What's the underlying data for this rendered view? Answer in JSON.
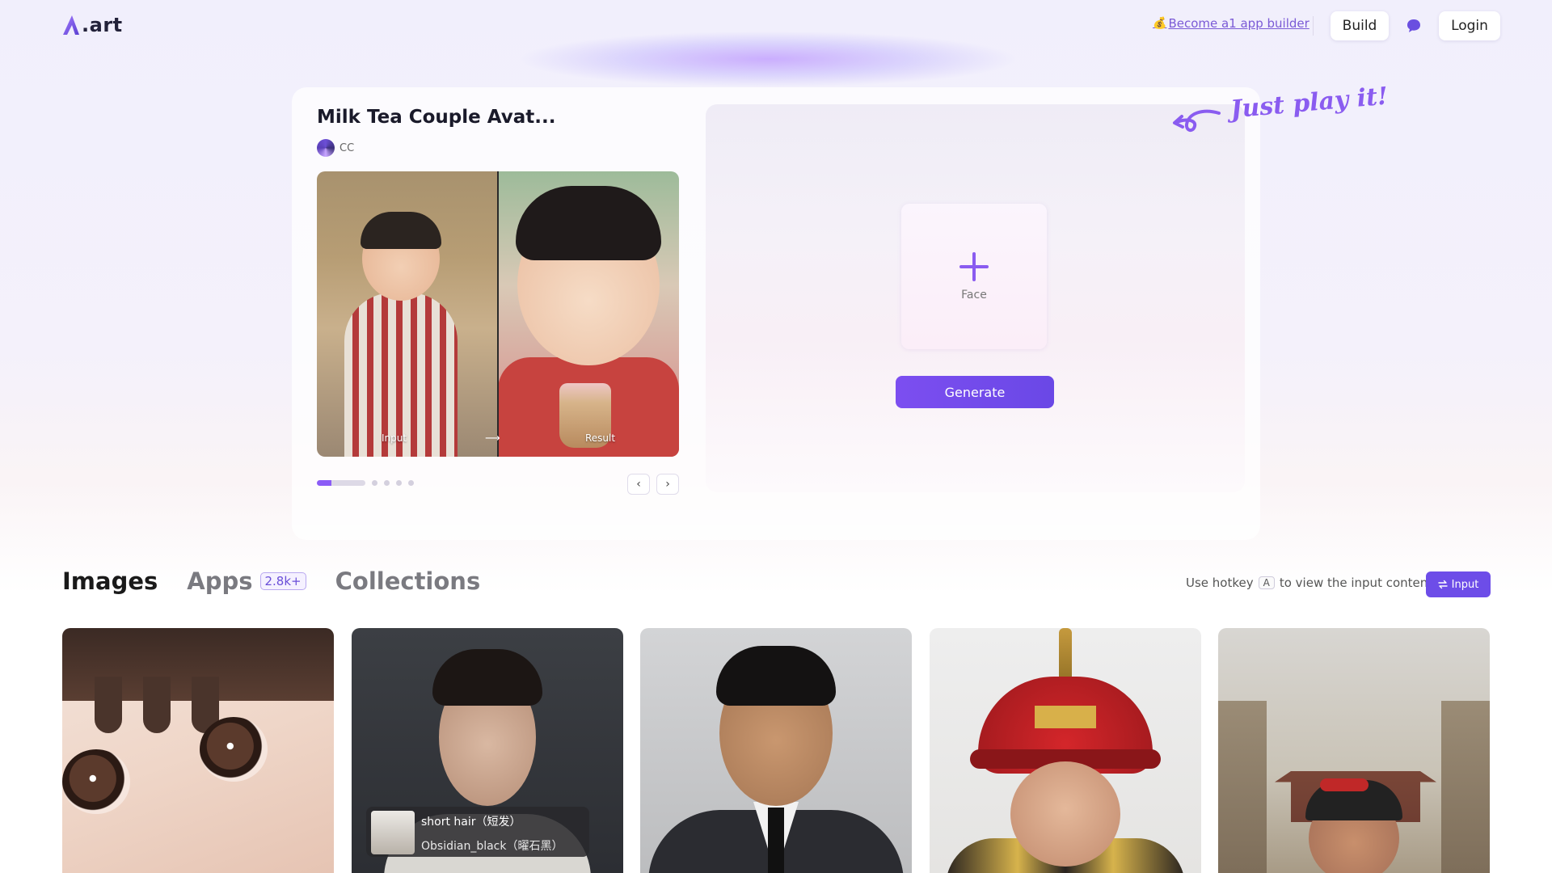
{
  "header": {
    "logo_text": ".art",
    "builder_link_icon": "money-bag-icon",
    "builder_link": "Become a1 app builder",
    "build_label": "Build",
    "chat_icon": "chat-bubble-icon",
    "login_label": "Login"
  },
  "hero": {
    "title": "Milk Tea Couple Avat...",
    "author": "CC",
    "compare": {
      "input_label": "Input",
      "arrow": "⟶",
      "result_label": "Result"
    },
    "carousel": {
      "total_slides": 5,
      "active_index": 0,
      "prev_label": "‹",
      "next_label": "›"
    },
    "play_hint": "Just play it!",
    "upload": {
      "icon": "plus-icon",
      "label": "Face"
    },
    "generate_label": "Generate"
  },
  "colors": {
    "accent": "#7c4ef0",
    "accent_dark": "#6d4de8",
    "text_dark": "#1a1a2a",
    "tab_inactive": "#7a7a80"
  },
  "tabs": {
    "items": [
      {
        "label": "Images",
        "active": true
      },
      {
        "label": "Apps",
        "badge": "2.8k+",
        "active": false
      },
      {
        "label": "Collections",
        "active": false
      }
    ],
    "hotkey_prefix": "Use hotkey",
    "hotkey_key": "A",
    "hotkey_suffix": "to view the input content",
    "input_button_icon": "swap-icon",
    "input_button_label": "Input"
  },
  "gallery": {
    "cards": [
      {
        "subject": "anime girl close-up"
      },
      {
        "subject": "man portrait",
        "overlay_line1": "short hair（短发）",
        "overlay_line2": "Obsidian_black（曜石黑）"
      },
      {
        "subject": "man in suit"
      },
      {
        "subject": "man in emperor costume"
      },
      {
        "subject": "man at great wall"
      }
    ]
  }
}
